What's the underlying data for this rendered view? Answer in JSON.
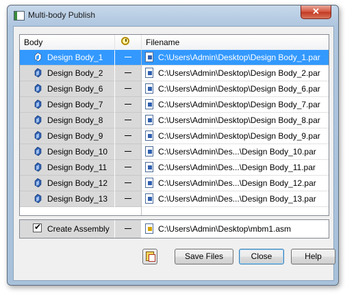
{
  "window": {
    "title": "Multi-body Publish",
    "close_glyph": "✕"
  },
  "grid": {
    "columns": {
      "body": "Body",
      "status_icon": "clock-icon",
      "filename": "Filename"
    },
    "rows": [
      {
        "body": "Design Body_1",
        "status": "—",
        "filename": "C:\\Users\\Admin\\Desktop\\Design Body_1.par",
        "selected": true
      },
      {
        "body": "Design Body_2",
        "status": "—",
        "filename": "C:\\Users\\Admin\\Desktop\\Design Body_2.par"
      },
      {
        "body": "Design Body_6",
        "status": "—",
        "filename": "C:\\Users\\Admin\\Desktop\\Design Body_6.par"
      },
      {
        "body": "Design Body_7",
        "status": "—",
        "filename": "C:\\Users\\Admin\\Desktop\\Design Body_7.par"
      },
      {
        "body": "Design Body_8",
        "status": "—",
        "filename": "C:\\Users\\Admin\\Desktop\\Design Body_8.par"
      },
      {
        "body": "Design Body_9",
        "status": "—",
        "filename": "C:\\Users\\Admin\\Desktop\\Design Body_9.par"
      },
      {
        "body": "Design Body_10",
        "status": "—",
        "filename": "C:\\Users\\Admin\\Des...\\Design Body_10.par"
      },
      {
        "body": "Design Body_11",
        "status": "—",
        "filename": "C:\\Users\\Admin\\Des...\\Design Body_11.par"
      },
      {
        "body": "Design Body_12",
        "status": "—",
        "filename": "C:\\Users\\Admin\\Des...\\Design Body_12.par"
      },
      {
        "body": "Design Body_13",
        "status": "—",
        "filename": "C:\\Users\\Admin\\Des...\\Design Body_13.par"
      }
    ]
  },
  "assembly": {
    "label": "Create Assembly",
    "checked": true,
    "check_glyph": "✔",
    "status": "—",
    "filename": "C:\\Users\\Admin\\Desktop\\mbm1.asm"
  },
  "buttons": {
    "save": "Save Files",
    "close": "Close",
    "help": "Help"
  },
  "colors": {
    "selection": "#3399ff",
    "body_icon": "#2f5fb0"
  }
}
